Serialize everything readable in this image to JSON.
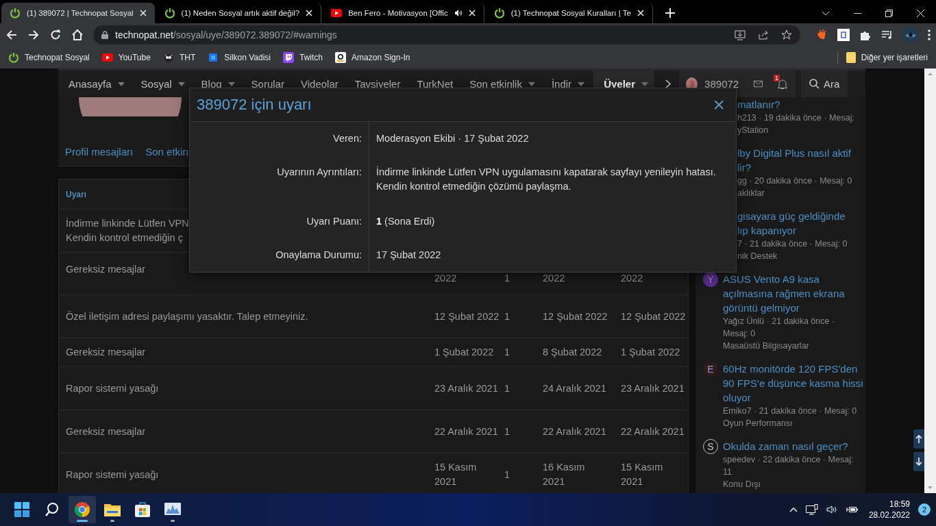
{
  "browser": {
    "tabs": [
      {
        "title": "(1) 389072 | Technopat Sosyal",
        "selected": true,
        "audio": false
      },
      {
        "title": "(1) Neden Sosyal artık aktif değil?",
        "selected": false,
        "audio": false
      },
      {
        "title": "Ben Fero - Motivasyon [Offic",
        "selected": false,
        "audio": true
      },
      {
        "title": "(1) Technopat Sosyal Kuralları | Te",
        "selected": false,
        "audio": false
      }
    ],
    "address": {
      "host": "technopat.net",
      "path": "/sosyal/uye/389072.389072/#warnings"
    },
    "bookmarks": [
      {
        "label": "Technopat Sosyal"
      },
      {
        "label": "YouTube"
      },
      {
        "label": "THT"
      },
      {
        "label": "Silkon Vadisi"
      },
      {
        "label": "Twitch"
      },
      {
        "label": "Amazon Sign-In"
      }
    ],
    "other_bookmarks": "Diğer yer işaretleri"
  },
  "nav": {
    "items": [
      {
        "label": "Anasayfa",
        "dropdown": true,
        "selected": false
      },
      {
        "label": "Sosyal",
        "dropdown": true,
        "selected": false
      },
      {
        "label": "Blog",
        "dropdown": true,
        "selected": false
      },
      {
        "label": "Sorular",
        "dropdown": false,
        "selected": false
      },
      {
        "label": "Videolar",
        "dropdown": false,
        "selected": false
      },
      {
        "label": "Tavsiyeler",
        "dropdown": false,
        "selected": false
      },
      {
        "label": "TurkNet",
        "dropdown": false,
        "selected": false
      },
      {
        "label": "Son etkinlik",
        "dropdown": true,
        "selected": false
      },
      {
        "label": "İndir",
        "dropdown": true,
        "selected": false
      },
      {
        "label": "Üyeler",
        "dropdown": true,
        "selected": true
      }
    ],
    "user": {
      "avatar": "3",
      "name": "389072"
    },
    "alerts": "1",
    "search": "Ara"
  },
  "profile": {
    "tabs": [
      "Profil mesajları",
      "Son etkin"
    ]
  },
  "warnings": {
    "heading": "Uyarı",
    "rows": [
      {
        "title_lines": [
          "İndirme linkinde Lütfen VPN",
          "Kendin kontrol etmediğin ç"
        ],
        "cells": []
      },
      {
        "title_lines": [
          "Gereksiz mesajlar"
        ],
        "cells": [
          "2022",
          "1",
          "2022",
          "2022"
        ]
      },
      {
        "title_lines": [
          "Özel iletişim adresi paylaşımı yasaktır. Talep etmeyiniz."
        ],
        "cells": [
          "12 Şubat 2022",
          "1",
          "12 Şubat 2022",
          "12 Şubat 2022"
        ]
      },
      {
        "title_lines": [
          "Gereksiz mesajlar"
        ],
        "cells": [
          "1 Şubat 2022",
          "1",
          "8 Şubat 2022",
          "1 Şubat 2022"
        ]
      },
      {
        "title_lines": [
          "Rapor sistemi yasağı"
        ],
        "cells": [
          "23 Aralık 2021",
          "1",
          "24 Aralık 2021",
          "23 Aralık 2021"
        ]
      },
      {
        "title_lines": [
          "Gereksiz mesajlar"
        ],
        "cells": [
          "22 Aralık 2021",
          "1",
          "22 Aralık 2021",
          "22 Aralık 2021"
        ]
      },
      {
        "title_lines": [
          "Rapor sistemi yasağı"
        ],
        "cells": [
          "15 Kasım 2021",
          "1",
          "16 Kasım 2021",
          "15 Kasım 2021"
        ]
      }
    ]
  },
  "sidebar": {
    "threads": [
      {
        "kind": "partial",
        "title_lines": [
          "matlanır?"
        ],
        "meta_lines": [
          "h213 · 19 dakika önce · Mesaj:"
        ],
        "forum": "yStation"
      },
      {
        "kind": "partial",
        "title_lines": [
          "lby Digital Plus nasıl aktif",
          "lir?"
        ],
        "meta_lines": [
          "gg · 20 dakika önce · Mesaj: 0"
        ],
        "forum": "aklıklar"
      },
      {
        "kind": "partial",
        "title_lines": [
          "gisayara güç geldiğinde",
          "lıp kapanıyor"
        ],
        "meta_lines": [
          "7 · 21 dakika önce · Mesaj: 0"
        ],
        "forum": "nik Destek"
      },
      {
        "kind": "full",
        "avatar": "Y",
        "color": "#5a2d91",
        "outlined": false,
        "title_lines": [
          "ASUS Vento A9 kasa",
          "açılmasına rağmen ekrana",
          "görüntü gelmiyor"
        ],
        "meta_lines": [
          "Yağız Ünlü · 21 dakika önce ·",
          "Mesaj: 0"
        ],
        "forum": "Masaüstü Bilgisayarlar"
      },
      {
        "kind": "full",
        "avatar": "E",
        "color": "#2e1b1b",
        "outlined": false,
        "title_lines": [
          "60Hz monitörde 120 FPS'den",
          "90 FPS'e düşünce kasma hissi",
          "oluyor"
        ],
        "meta_lines": [
          "Emiko7 · 21 dakika önce · Mesaj: 0"
        ],
        "forum": "Oyun Performansı"
      },
      {
        "kind": "full",
        "avatar": "S",
        "color": "#1a1a1a",
        "outlined": true,
        "title_lines": [
          "Okulda zaman nasıl geçer?"
        ],
        "meta_lines": [
          "speedev · 22 dakika önce · Mesaj:",
          "11"
        ],
        "forum": "Konu Dışı"
      }
    ]
  },
  "modal": {
    "title": "389072 için uyarı",
    "close": "×",
    "rows": [
      {
        "label": "Veren:",
        "value": "Moderasyon Ekibi · 17 Şubat 2022"
      },
      {
        "label": "Uyarının Ayrıntıları:",
        "value": "İndirme linkinde Lütfen VPN uygulamasını kapatarak sayfayı yenileyin hatası. Kendin kontrol etmediğin çözümü paylaşma."
      },
      {
        "label": "Uyarı Puanı:",
        "value": "**1** (Sona Erdi)"
      },
      {
        "label": "Onaylama Durumu:",
        "value": "17 Şubat 2022"
      }
    ]
  },
  "taskbar": {
    "apps": [
      {
        "open": false,
        "selected": false
      },
      {
        "open": false,
        "selected": false
      },
      {
        "open": true,
        "selected": true
      },
      {
        "open": true,
        "selected": false
      },
      {
        "open": false,
        "selected": false
      },
      {
        "open": true,
        "selected": false
      }
    ],
    "time": "18:59",
    "date": "28.02.2022",
    "notifications": "2"
  }
}
